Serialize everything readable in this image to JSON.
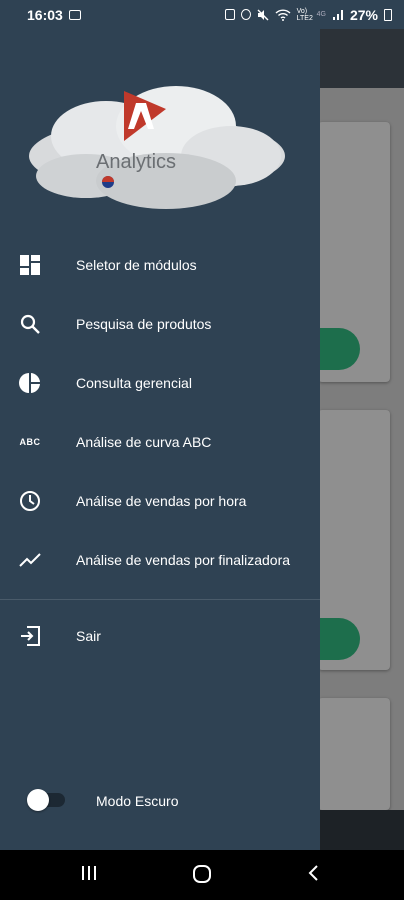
{
  "status_bar": {
    "time": "16:03",
    "network_small": "Vo)\nLTE2",
    "net_tag": "4G",
    "battery": "27%"
  },
  "logo": {
    "text": "Analytics",
    "brand_color": "#c0392b"
  },
  "menu": {
    "items": [
      {
        "label": "Seletor de módulos",
        "icon": "grid-icon"
      },
      {
        "label": "Pesquisa de produtos",
        "icon": "search-icon"
      },
      {
        "label": "Consulta gerencial",
        "icon": "pie-chart-icon"
      },
      {
        "label": "Análise de curva ABC",
        "icon": "abc-icon"
      },
      {
        "label": "Análise de vendas por hora",
        "icon": "clock-icon"
      },
      {
        "label": "Análise de vendas por finalizadora",
        "icon": "trending-up-icon"
      }
    ],
    "logout": {
      "label": "Sair",
      "icon": "logout-icon"
    }
  },
  "dark_mode": {
    "label": "Modo Escuro",
    "enabled": false
  },
  "colors": {
    "drawer_bg": "#2f4253",
    "accent_green": "#1d6e4c"
  }
}
